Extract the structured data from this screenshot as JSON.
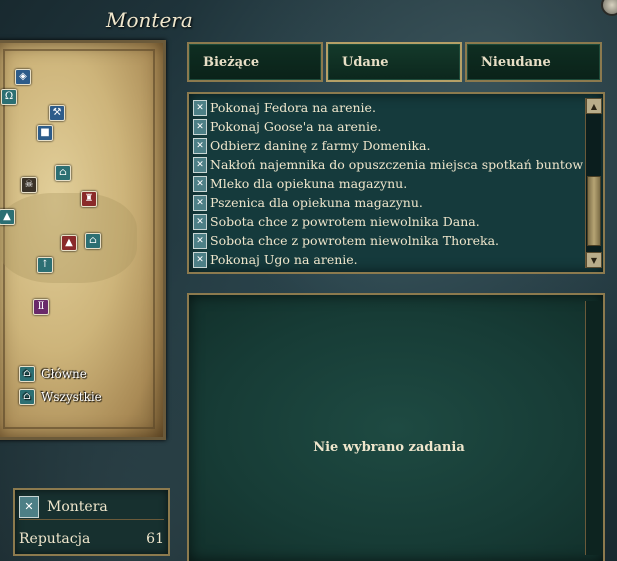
{
  "region_title": "Montera",
  "tabs": [
    {
      "label": "Bieżące"
    },
    {
      "label": "Udane"
    },
    {
      "label": "Nieudane"
    }
  ],
  "quests": [
    "Pokonaj Fedora na arenie.",
    "Pokonaj Goose'a na arenie.",
    "Odbierz daninę z farmy Domenika.",
    "Nakłoń najemnika do opuszczenia miejsca spotkań buntowników.",
    "Mleko dla opiekuna magazynu.",
    "Pszenica dla opiekuna magazynu.",
    "Sobota chce z powrotem niewolnika Dana.",
    "Sobota chce z powrotem niewolnika Thoreka.",
    "Pokonaj Ugo na arenie."
  ],
  "map_legend": {
    "main": "Główne",
    "all": "Wszystkie"
  },
  "description": {
    "empty_text": "Nie wybrano zadania"
  },
  "reputation": {
    "faction": "Montera",
    "label": "Reputacja",
    "value": "61"
  },
  "icons": {
    "quest_icon": "windmill-icon",
    "scroll_up": "arrow-up-icon",
    "scroll_down": "arrow-down-icon"
  },
  "colors": {
    "panel_bg": "#153a3c",
    "border_gold": "#8c7a4e",
    "tab_bg": "#0f2e22",
    "text": "#efe6cc"
  }
}
